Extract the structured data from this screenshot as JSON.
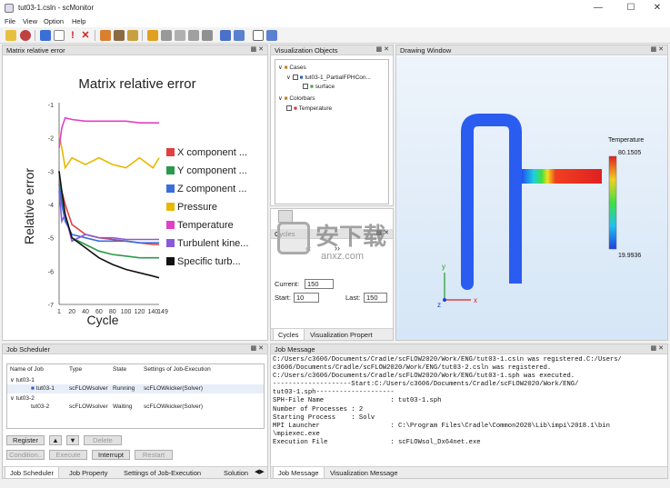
{
  "window": {
    "title": "tut03-1.csln - scMonitor"
  },
  "menu": [
    "File",
    "View",
    "Option",
    "Help"
  ],
  "chart_panel": {
    "header": "Matrix relative error",
    "chart_data": {
      "type": "line",
      "title": "Matrix relative error",
      "xlabel": "Cycle",
      "ylabel": "Relative error",
      "x_ticks": [
        "1",
        "20",
        "40",
        "60",
        "80",
        "100",
        "120",
        "140",
        "149"
      ],
      "y_ticks": [
        "-1",
        "-2",
        "-3",
        "-4",
        "-5",
        "-6",
        "-7"
      ],
      "ylim": [
        -7,
        -1
      ],
      "xlim": [
        1,
        149
      ],
      "series": [
        {
          "name": "X component ...",
          "color": "#e04040",
          "x": [
            1,
            5,
            10,
            20,
            40,
            60,
            80,
            100,
            120,
            140,
            149
          ],
          "y": [
            -3.3,
            -3.6,
            -4.0,
            -4.6,
            -4.9,
            -5.0,
            -5.05,
            -5.1,
            -5.15,
            -5.2,
            -5.2
          ]
        },
        {
          "name": "Y component ...",
          "color": "#2a9a4a",
          "x": [
            1,
            5,
            10,
            20,
            40,
            60,
            80,
            100,
            120,
            140,
            149
          ],
          "y": [
            -3.0,
            -3.8,
            -4.4,
            -5.0,
            -5.2,
            -5.4,
            -5.5,
            -5.55,
            -5.6,
            -5.6,
            -5.6
          ]
        },
        {
          "name": "Z component ...",
          "color": "#3a6fd8",
          "x": [
            1,
            5,
            10,
            20,
            40,
            60,
            80,
            100,
            120,
            140,
            149
          ],
          "y": [
            -3.4,
            -4.0,
            -4.5,
            -4.9,
            -5.0,
            -5.1,
            -5.1,
            -5.1,
            -5.15,
            -5.15,
            -5.15
          ]
        },
        {
          "name": "Pressure",
          "color": "#e8b800",
          "x": [
            1,
            5,
            10,
            20,
            40,
            60,
            80,
            100,
            120,
            140,
            149
          ],
          "y": [
            -1.9,
            -2.3,
            -2.9,
            -2.6,
            -2.8,
            -2.6,
            -2.8,
            -2.9,
            -2.6,
            -2.9,
            -2.6
          ]
        },
        {
          "name": "Temperature",
          "color": "#e040c8",
          "x": [
            1,
            5,
            10,
            20,
            40,
            60,
            80,
            100,
            120,
            140,
            149
          ],
          "y": [
            -2.3,
            -1.7,
            -1.4,
            -1.45,
            -1.5,
            -1.5,
            -1.5,
            -1.5,
            -1.55,
            -1.55,
            -1.55
          ]
        },
        {
          "name": "Turbulent kine...",
          "color": "#8a5ad8",
          "x": [
            1,
            5,
            10,
            20,
            40,
            60,
            80,
            100,
            120,
            140,
            149
          ],
          "y": [
            -3.6,
            -4.5,
            -4.3,
            -5.1,
            -4.9,
            -5.0,
            -5.0,
            -5.05,
            -5.05,
            -5.05,
            -5.05
          ]
        },
        {
          "name": "Specific turb...",
          "color": "#111111",
          "x": [
            1,
            5,
            10,
            20,
            40,
            60,
            80,
            100,
            120,
            140,
            149
          ],
          "y": [
            -3.0,
            -3.6,
            -4.3,
            -5.0,
            -5.3,
            -5.6,
            -5.8,
            -5.95,
            -6.05,
            -6.15,
            -6.2
          ]
        }
      ]
    }
  },
  "viz_objects": {
    "header": "Visualization Objects",
    "tree": [
      {
        "label": "Cases"
      },
      {
        "label": "tut03-1_PartialFPHCon..."
      },
      {
        "label": "surface"
      },
      {
        "label": "Colorbars"
      },
      {
        "label": "Temperature"
      }
    ]
  },
  "cycles": {
    "header": "Cycles",
    "current_label": "Current:",
    "current_value": "150",
    "start_label": "Start:",
    "start_value": "10",
    "last_label": "Last:",
    "last_value": "150",
    "tabs": [
      "Cycles",
      "Visualization Propert"
    ]
  },
  "drawing": {
    "header": "Drawing Window",
    "colorbar_title": "Temperature",
    "colorbar_max": "80.1505",
    "colorbar_min": "19.9936",
    "axis_y": "y",
    "axis_x": "x",
    "axis_z": "z"
  },
  "job_scheduler": {
    "header": "Job Scheduler",
    "columns": [
      "Name of Job",
      "Type",
      "State",
      "Settings of Job-Execution"
    ],
    "rows": [
      {
        "name": "tut03-1",
        "type": "",
        "state": "",
        "settings": ""
      },
      {
        "name": "tut03-1",
        "type": "scFLOWsolver",
        "state": "Running",
        "settings": "scFLOWkicker(Solver)"
      },
      {
        "name": "tut03-2",
        "type": "",
        "state": "",
        "settings": ""
      },
      {
        "name": "tut03-2",
        "type": "scFLOWsolver",
        "state": "Waiting",
        "settings": "scFLOWkicker(Solver)"
      }
    ],
    "buttons": {
      "register": "Register",
      "delete": "Delete",
      "condition": "Condition..",
      "execute": "Execute",
      "interrupt": "Interrupt",
      "restart": "Restart"
    },
    "tabs": [
      "Job Scheduler",
      "Job Property",
      "Settings of Job-Execution",
      "Solution"
    ]
  },
  "job_message": {
    "header": "Job Message",
    "lines": [
      "C:/Users/c3606/Documents/Cradle/scFLOW2020/Work/ENG/tut03-1.csln was registered.C:/Users/",
      "c3606/Documents/Cradle/scFLOW2020/Work/ENG/tut03-2.csln was registered.",
      "C:/Users/c3606/Documents/Cradle/scFLOW2020/Work/ENG/tut03-1.sph was executed.",
      "--------------------Start:C:/Users/c3606/Documents/Cradle/scFLOW2020/Work/ENG/",
      "tut03-1.sph--------------------",
      "SPH-File Name                 : tut03-1.sph",
      "Number of Processes : 2",
      "Starting Process    : Solv",
      "MPI Launcher                  : C:\\Program Files\\Cradle\\Common2020\\Lib\\impi\\2018.1\\bin",
      "\\mpiexec.exe",
      "Execution File                : scFLOWsol_Dx64net.exe"
    ],
    "tabs": [
      "Job Message",
      "Visualization Message"
    ]
  },
  "watermark": {
    "text": "安下载",
    "sub": "anxz.com"
  }
}
